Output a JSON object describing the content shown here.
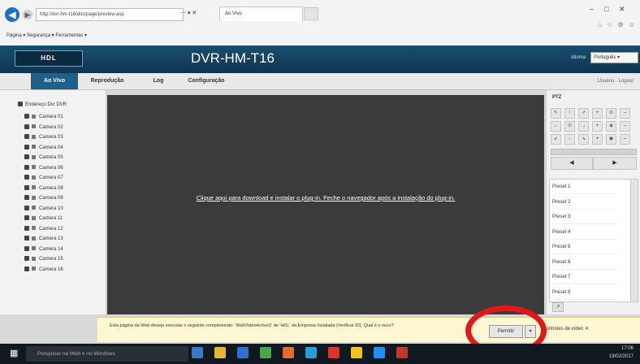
{
  "browser": {
    "back_icon": "back-arrow-icon",
    "address": "http://dvr-hm-t16/doc/page/preview.asp",
    "tools": "⋯ ▾ ✕",
    "tab_title": "Ao Vivo",
    "command_bar": "Página ▾   Segurança ▾   Ferramentas ▾",
    "window_min": "–",
    "window_max": "□",
    "window_close": "✕",
    "icons": "⌂ ☆ ⚙ ☺"
  },
  "app": {
    "logo": "HDL",
    "title": "DVR-HM-T16",
    "lang_label": "Idioma",
    "lang_value": "Português ▾"
  },
  "nav": {
    "tabs": [
      "Ao Vivo",
      "Reprodução",
      "Log",
      "Configuração"
    ],
    "active_color": "#1f5f88",
    "user": "Usuário · Logout"
  },
  "tree": {
    "root": "Endereço Dvr DVR",
    "cameras": [
      "Camera 01",
      "Camera 02",
      "Camera 03",
      "Camera 04",
      "Camera 05",
      "Camera 06",
      "Camera 07",
      "Camera 08",
      "Camera 09",
      "Camera 10",
      "Camera 11",
      "Camera 12",
      "Camera 13",
      "Camera 14",
      "Camera 15",
      "Camera 16"
    ]
  },
  "video": {
    "plugin_message": "Clique aqui para download e instalar o plug-in. Feche o navegador após a instalação do plug-in."
  },
  "ptz": {
    "title": "PTZ",
    "rows": [
      [
        "↖",
        "↑",
        "↗",
        "+",
        "⊙",
        "–"
      ],
      [
        "←",
        "⊙",
        "→",
        "+",
        "◈",
        "–"
      ],
      [
        "↙",
        "↓",
        "↘",
        "+",
        "◉",
        "–"
      ]
    ],
    "prev_label": "◀",
    "next_label": "▶",
    "presets": [
      "Preset 1",
      "Preset 2",
      "Preset 3",
      "Preset 4",
      "Preset 5",
      "Preset 6",
      "Preset 7",
      "Preset 8"
    ],
    "go_label": "↗"
  },
  "notification": {
    "text": "Esta página da Web deseja executar o seguinte complemento: 'WebVideoActiveX' de 'HDL' da Empresa Instalada (Verificar ID). Qual é o risco?",
    "button": "Permitir",
    "dropdown": "▾",
    "close": "Controles de vídeo  ✕",
    "highlight_color": "#e01818"
  },
  "taskbar": {
    "start_icon": "windows-start-icon",
    "search_placeholder": "Pesquisar na Web e no Windows",
    "icons": [
      "#3a78c9",
      "#e8b43a",
      "#2f6fd0",
      "#4aa64a",
      "#e56b2a",
      "#2a9cdc",
      "#d33",
      "#f0c419",
      "#1e90ff",
      "#c0392b"
    ],
    "tray_time": "17:06",
    "tray_date": "19/02/2017"
  }
}
